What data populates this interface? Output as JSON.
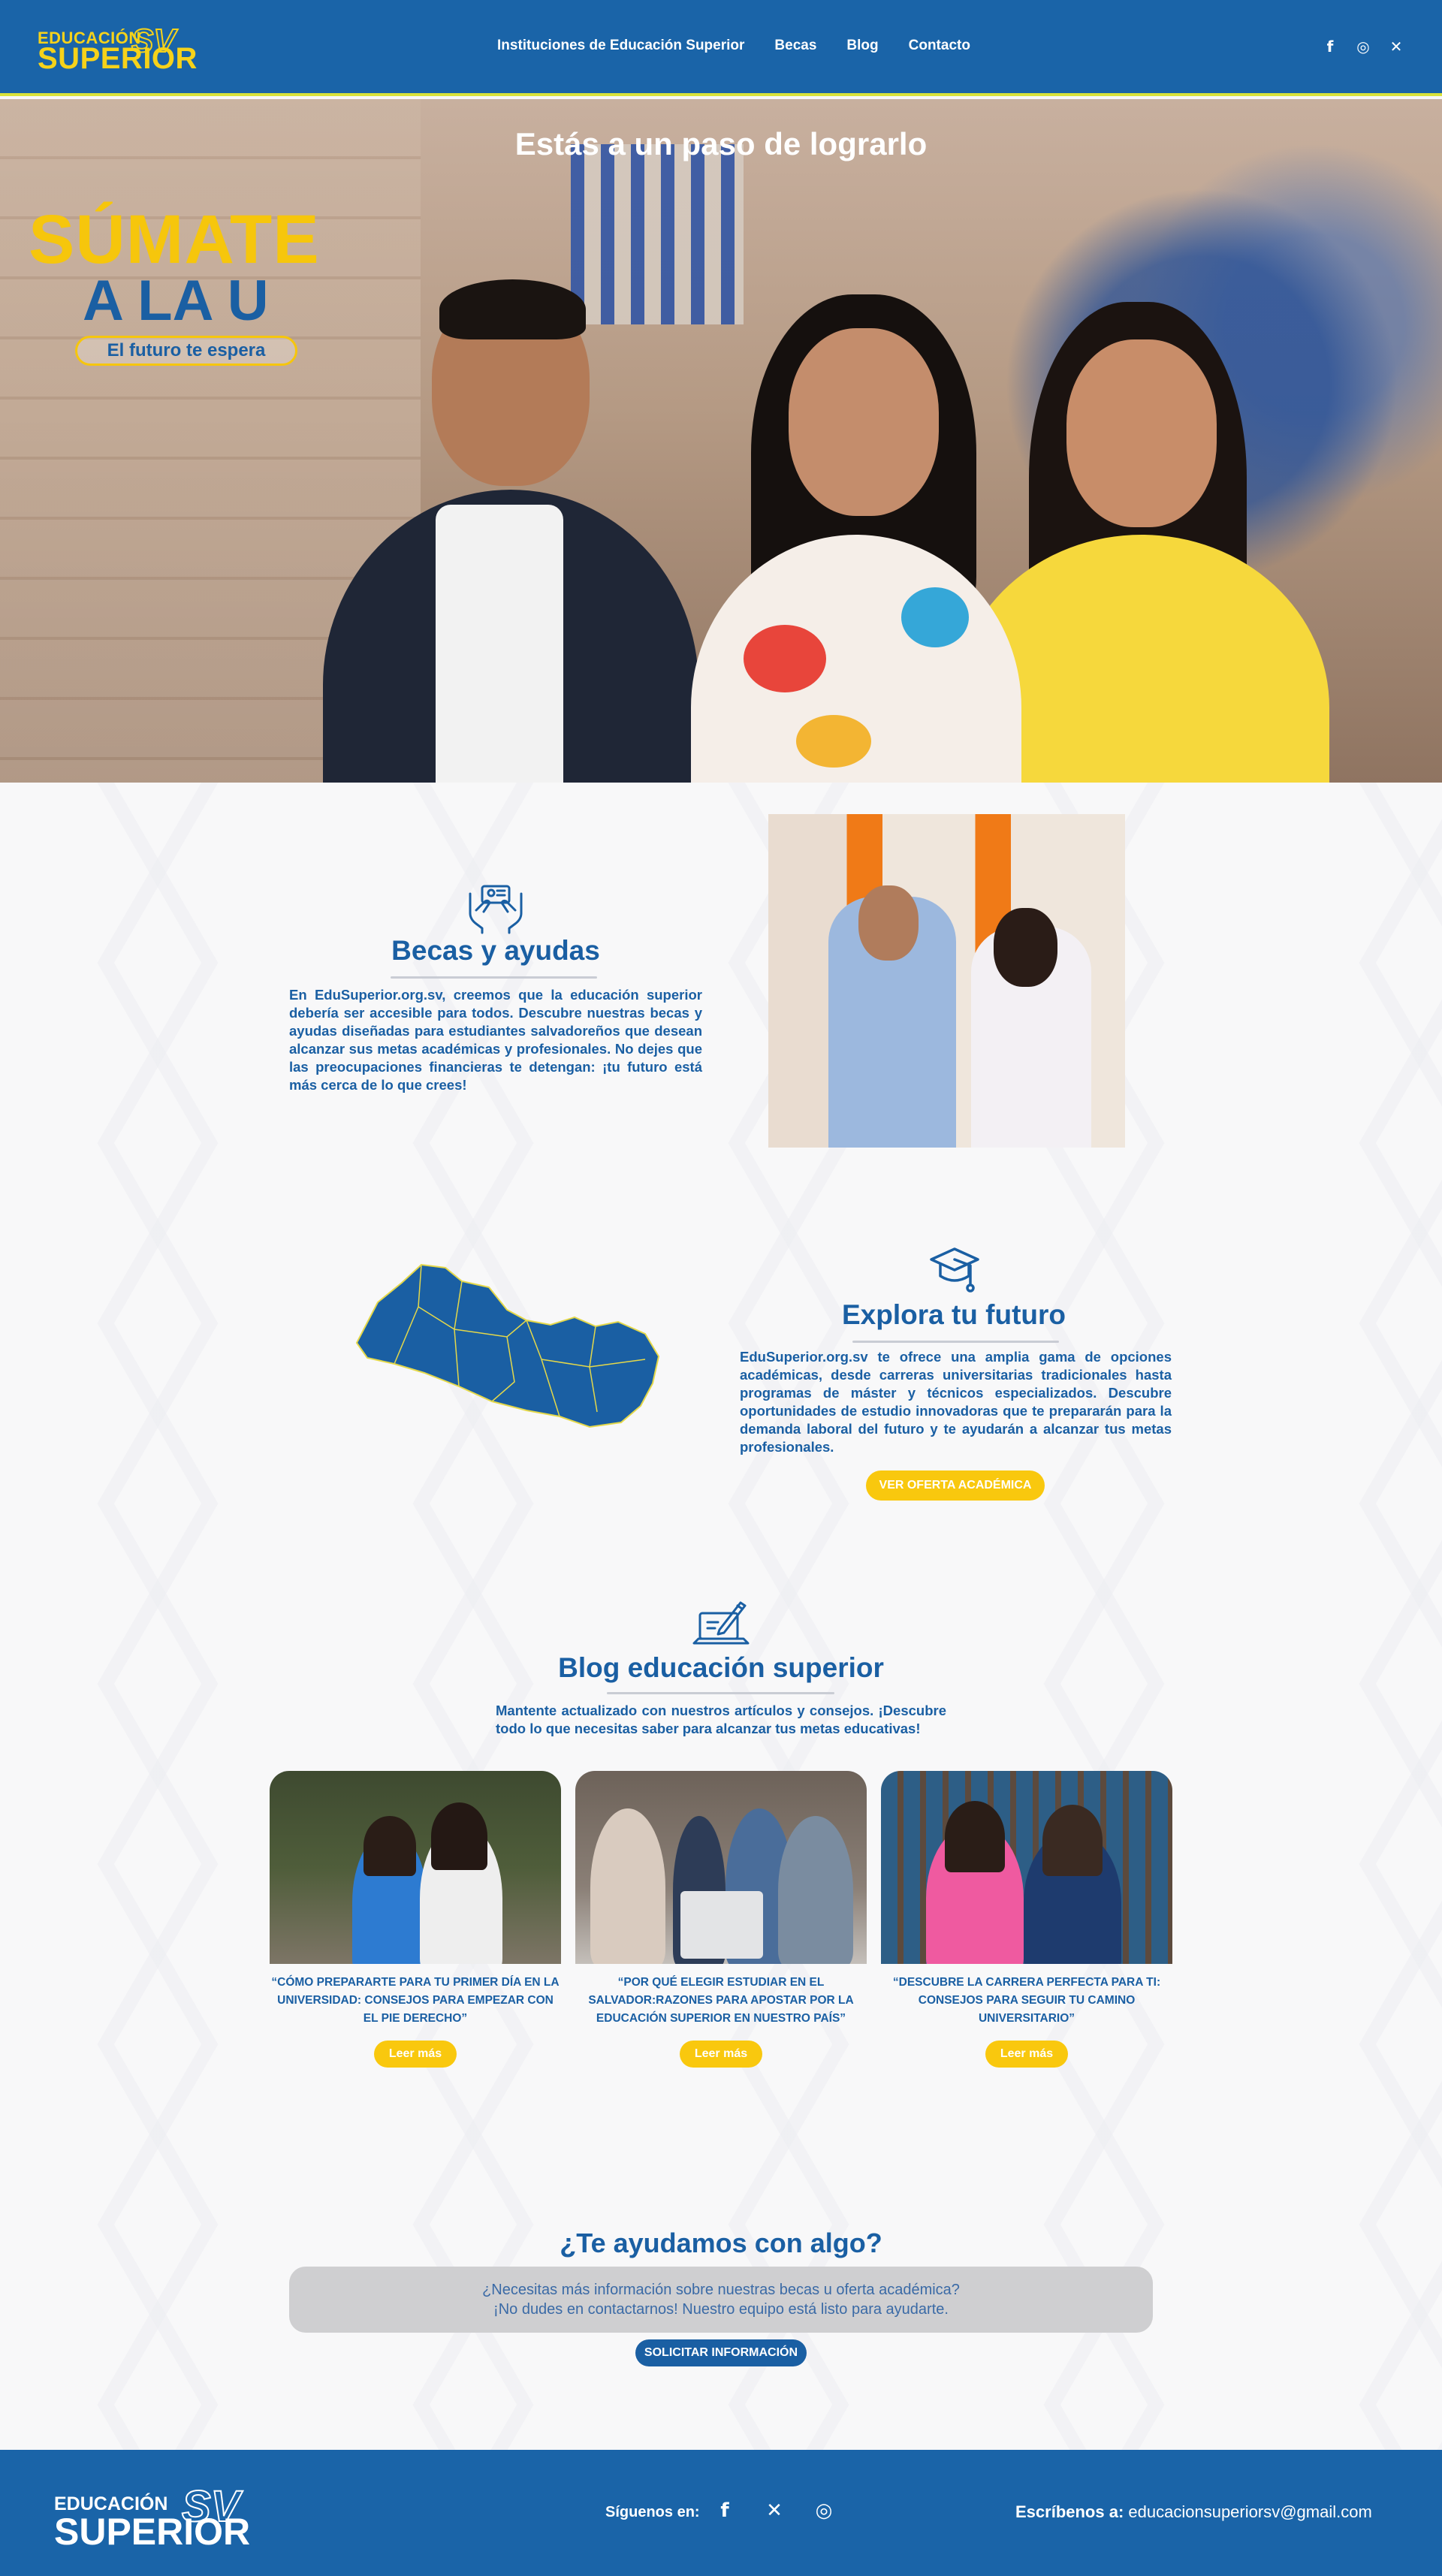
{
  "header": {
    "logo_top": "EDUCACIÓN",
    "logo_main": "SUPERIOR",
    "logo_sv": "SV",
    "nav": [
      "Instituciones de Educación Superior",
      "Becas",
      "Blog",
      "Contacto"
    ],
    "social_icons": [
      "facebook-icon",
      "instagram-icon",
      "x-icon"
    ]
  },
  "hero": {
    "title": "Estás a un paso de lograrlo",
    "sumate_line1": "SÚMATE",
    "sumate_line2": "A LA U",
    "sumate_tagline": "El futuro te espera"
  },
  "becas": {
    "icon": "hands-scholarship-icon",
    "title": "Becas y ayudas",
    "text": "En EduSuperior.org.sv, creemos que la educación superior debería ser accesible para todos. Descubre nuestras becas y ayudas diseñadas para estudiantes salvadoreños que desean alcanzar sus metas académicas y profesionales. No dejes que las preocupaciones financieras te detengan: ¡tu futuro está más cerca de lo que crees!"
  },
  "explora": {
    "icon": "graduation-cap-icon",
    "title": "Explora tu futuro",
    "text": "EduSuperior.org.sv te ofrece una amplia gama de opciones académicas, desde carreras universitarias tradicionales hasta programas de máster y técnicos especializados. Descubre oportunidades de estudio innovadoras que te prepararán para la demanda laboral del futuro y te ayudarán a alcanzar tus metas profesionales.",
    "button": "VER OFERTA ACADÉMICA"
  },
  "blog": {
    "icon": "laptop-writing-icon",
    "title": "Blog educación superior",
    "subtitle": "Mantente actualizado con nuestros artículos y consejos. ¡Descubre todo lo que necesitas saber para alcanzar tus metas educativas!",
    "cards": [
      {
        "caption": "“CÓMO PREPARARTE PARA TU PRIMER DÍA EN LA UNIVERSIDAD: CONSEJOS PARA EMPEZAR CON EL PIE DERECHO”",
        "button": "Leer más"
      },
      {
        "caption": "“POR QUÉ ELEGIR ESTUDIAR EN EL SALVADOR:RAZONES PARA APOSTAR POR LA EDUCACIÓN SUPERIOR EN NUESTRO PAÍS”",
        "button": "Leer más"
      },
      {
        "caption": "“DESCUBRE LA CARRERA PERFECTA PARA TI: CONSEJOS PARA SEGUIR TU CAMINO UNIVERSITARIO”",
        "button": "Leer más"
      }
    ]
  },
  "help": {
    "title": "¿Te ayudamos con algo?",
    "line1": "¿Necesitas más información sobre nuestras becas u oferta académica?",
    "line2": "¡No dudes en contactarnos! Nuestro equipo está listo para ayudarte.",
    "button": "SOLICITAR INFORMACIÓN"
  },
  "footer": {
    "logo_top": "EDUCACIÓN",
    "logo_main": "SUPERIOR",
    "logo_sv": "SV",
    "follow_label": "Síguenos en:",
    "social_icons": [
      "facebook-icon",
      "x-icon",
      "instagram-icon"
    ],
    "contact_label": "Escríbenos a:",
    "contact_email": "educacionsuperiorsv@gmail.com"
  },
  "colors": {
    "brand_blue": "#1a64a8",
    "brand_yellow": "#f9c80e"
  }
}
